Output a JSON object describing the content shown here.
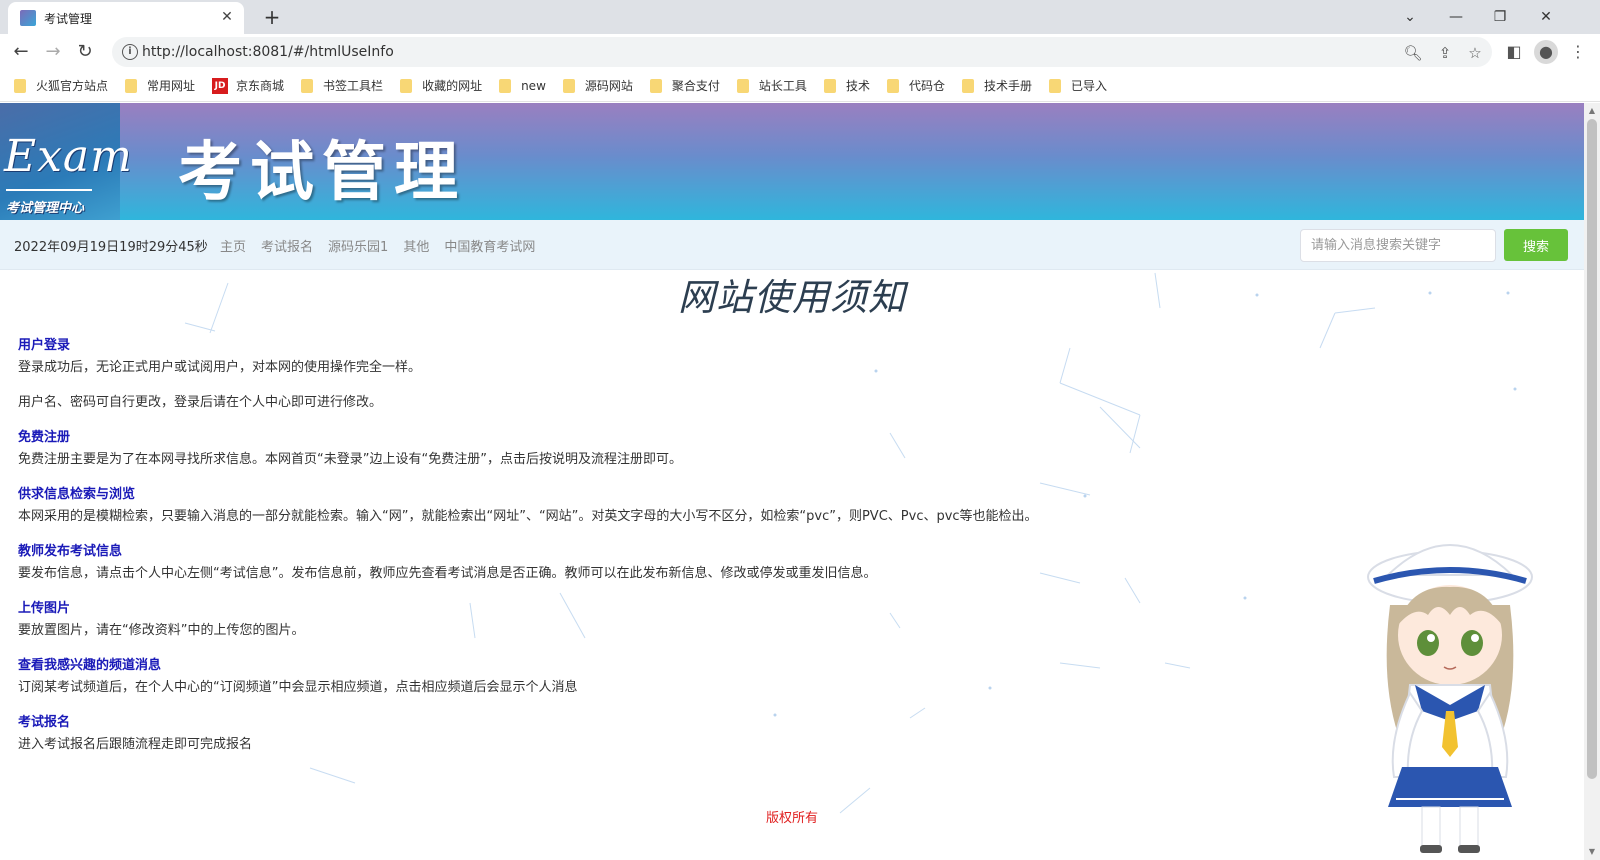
{
  "browser": {
    "tab_title": "考试管理",
    "url": "http://localhost:8081/#/htmlUseInfo",
    "bookmarks": [
      "火狐官方站点",
      "常用网址",
      "京东商城",
      "书签工具栏",
      "收藏的网址",
      "new",
      "源码网站",
      "聚合支付",
      "站长工具",
      "技术",
      "代码仓",
      "技术手册",
      "已导入"
    ],
    "jd_badge": "JD"
  },
  "header": {
    "logo_text": "Exam",
    "logo_sub": "考试管理中心",
    "title": "考试管理"
  },
  "navbar": {
    "datetime": "2022年09月19日19时29分45秒",
    "links": [
      "主页",
      "考试报名",
      "源码乐园1",
      "其他",
      "中国教育考试网"
    ],
    "search_placeholder": "请输入消息搜索关键字",
    "search_button": "搜索"
  },
  "page": {
    "heading": "网站使用须知",
    "sections": [
      {
        "title": "用户登录",
        "paragraphs": [
          "登录成功后，无论正式用户或试阅用户，对本网的使用操作完全一样。",
          "用户名、密码可自行更改，登录后请在个人中心即可进行修改。"
        ]
      },
      {
        "title": "免费注册",
        "paragraphs": [
          "免费注册主要是为了在本网寻找所求信息。本网首页“未登录”边上设有“免费注册”，点击后按说明及流程注册即可。"
        ]
      },
      {
        "title": "供求信息检索与浏览",
        "paragraphs": [
          "本网采用的是模糊检索，只要输入消息的一部分就能检索。输入“网”，就能检索出“网址”、“网站”。对英文字母的大小写不区分，如检索“pvc”，则PVC、Pvc、pvc等也能检出。"
        ]
      },
      {
        "title": "教师发布考试信息",
        "paragraphs": [
          "要发布信息，请点击个人中心左侧“考试信息”。发布信息前，教师应先查看考试消息是否正确。教师可以在此发布新信息、修改或停发或重发旧信息。"
        ]
      },
      {
        "title": "上传图片",
        "paragraphs": [
          "要放置图片，请在“修改资料”中的上传您的图片。"
        ]
      },
      {
        "title": "查看我感兴趣的频道消息",
        "paragraphs": [
          "订阅某考试频道后，在个人中心的“订阅频道”中会显示相应频道，点击相应频道后会显示个人消息"
        ]
      },
      {
        "title": "考试报名",
        "paragraphs": [
          "进入考试报名后跟随流程走即可完成报名"
        ]
      }
    ],
    "footer": "版权所有"
  },
  "colors": {
    "accent_green": "#67c23a",
    "section_title": "#1a1ab8",
    "footer_red": "#e02020",
    "navbar_bg": "#e9f3fa"
  }
}
